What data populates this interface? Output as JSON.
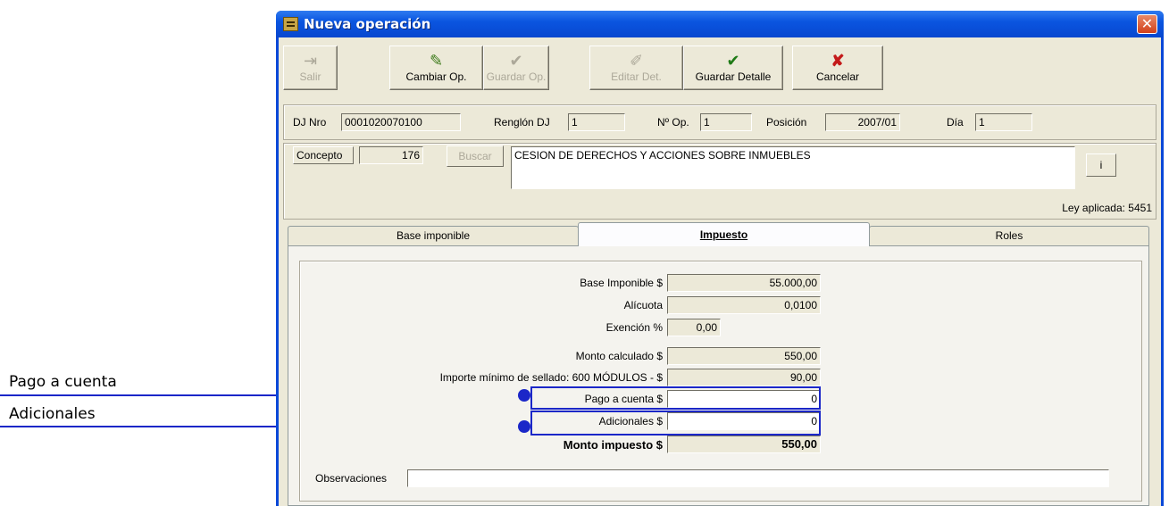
{
  "annotations": {
    "pago_label": "Pago a cuenta",
    "adicionales_label": "Adicionales",
    "highlight_color": "#1b27c8"
  },
  "window": {
    "title": "Nueva operación",
    "close_glyph": "✕"
  },
  "toolbar": {
    "salir": "Salir",
    "cambiar": "Cambiar Op.",
    "guardar_op": "Guardar Op.",
    "editar": "Editar Det.",
    "guardar_detalle": "Guardar Detalle",
    "cancelar": "Cancelar"
  },
  "header": {
    "dj_label": "DJ Nro",
    "dj_value": "0001020070100",
    "renglon_label": "Renglón DJ",
    "renglon_value": "1",
    "nop_label": "Nº Op.",
    "nop_value": "1",
    "posicion_label": "Posición",
    "posicion_value": "2007/01",
    "dia_label": "Día",
    "dia_value": "1"
  },
  "concepto": {
    "label": "Concepto",
    "code": "176",
    "buscar": "Buscar",
    "description": "CESION DE DERECHOS Y ACCIONES SOBRE INMUEBLES",
    "info_button": "i",
    "ley": "Ley aplicada: 5451"
  },
  "tabs": [
    "Base imponible",
    "Impuesto",
    "Roles"
  ],
  "impuesto": {
    "base_label": "Base Imponible $",
    "base_value": "55.000,00",
    "alicuota_label": "Alícuota",
    "alicuota_value": "0,0100",
    "exencion_label": "Exención %",
    "exencion_value": "0,00",
    "monto_calc_label": "Monto calculado  $",
    "monto_calc_value": "550,00",
    "importe_min_label": "Importe mínimo de sellado: 600 MÓDULOS -  $",
    "importe_min_value": "90,00",
    "pago_label": "Pago a cuenta  $",
    "pago_value": "0",
    "adicionales_label": "Adicionales  $",
    "adicionales_value": "0",
    "monto_imp_label": "Monto impuesto  $",
    "monto_imp_value": "550,00",
    "observaciones_label": "Observaciones",
    "observaciones_value": ""
  }
}
